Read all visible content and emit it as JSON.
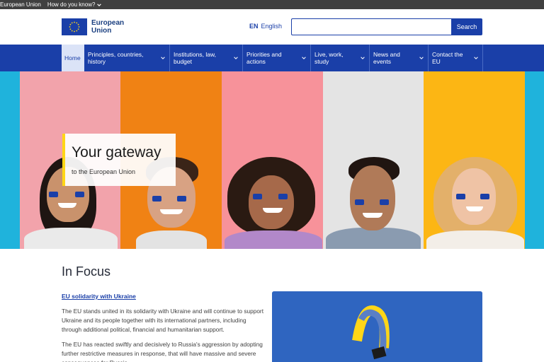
{
  "topbar": {
    "site_name": "European Union",
    "know_label": "How do you know?"
  },
  "header": {
    "logo_text_line1": "European",
    "logo_text_line2": "Union",
    "lang_code": "EN",
    "lang_name": "English",
    "search_placeholder": "",
    "search_label": "Search"
  },
  "nav": {
    "home": "Home",
    "items": [
      {
        "line1": "Principles, countries,",
        "line2": "history"
      },
      {
        "line1": "Institutions, law,",
        "line2": "budget"
      },
      {
        "line1": "Priorities and",
        "line2": "actions"
      },
      {
        "line1": "Live, work,",
        "line2": "study"
      },
      {
        "line1": "News and",
        "line2": "events"
      },
      {
        "line1": "Contact the",
        "line2": "EU"
      }
    ]
  },
  "hero": {
    "title": "Your gateway",
    "subtitle": "to the European Union"
  },
  "focus": {
    "title": "In Focus",
    "link": "EU solidarity with Ukraine",
    "para1": "The EU stands united in its solidarity with Ukraine and will continue to support Ukraine and its people together with its international partners, including through additional political, financial and humanitarian support.",
    "para2": "The EU has reacted swiftly and decisively to Russia's aggression by adopting further restrictive measures in response, that will have massive and severe consequences for Russia."
  },
  "colors": {
    "brand_blue": "#1a3fa8",
    "accent_yellow": "#ffd617"
  }
}
